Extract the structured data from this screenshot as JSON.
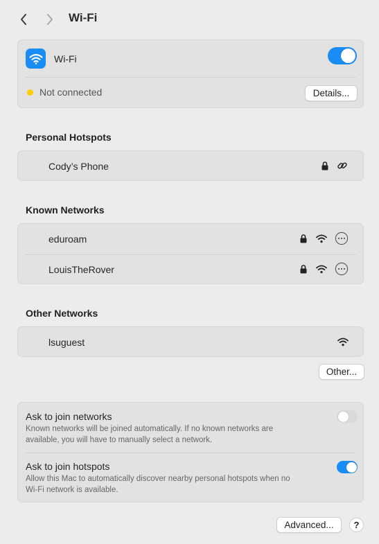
{
  "header": {
    "title": "Wi-Fi"
  },
  "wifi": {
    "label": "Wi-Fi",
    "enabled": true,
    "status_text": "Not connected",
    "status_color": "#ffcc00",
    "details_button": "Details..."
  },
  "personal_hotspots": {
    "title": "Personal Hotspots",
    "items": [
      {
        "name": "Cody’s Phone",
        "icons": [
          "lock-icon",
          "link-icon"
        ]
      }
    ]
  },
  "known_networks": {
    "title": "Known Networks",
    "items": [
      {
        "name": "eduroam",
        "icons": [
          "lock-icon",
          "wifi-signal-icon",
          "more-icon"
        ]
      },
      {
        "name": "LouisTheRover",
        "icons": [
          "lock-icon",
          "wifi-signal-icon",
          "more-icon"
        ]
      }
    ]
  },
  "other_networks": {
    "title": "Other Networks",
    "items": [
      {
        "name": "lsuguest",
        "icons": [
          "wifi-signal-icon"
        ]
      }
    ],
    "other_button": "Other..."
  },
  "options": {
    "ask_networks": {
      "title": "Ask to join networks",
      "description_line1": "Known networks will be joined automatically. If no known networks are",
      "description_line2": "available, you will have to manually select a network.",
      "enabled": false
    },
    "ask_hotspots": {
      "title": "Ask to join hotspots",
      "description_line1": "Allow this Mac to automatically discover nearby personal hotspots when no",
      "description_line2": "Wi-Fi network is available.",
      "enabled": true
    }
  },
  "footer": {
    "advanced_button": "Advanced...",
    "help_button": "?"
  },
  "colors": {
    "accent": "#1a8cf5",
    "toggle_off": "#d9d9d9"
  }
}
